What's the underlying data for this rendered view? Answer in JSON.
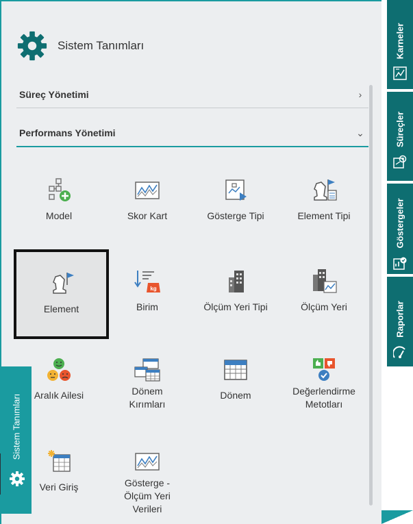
{
  "panel": {
    "title": "Sistem Tanımları",
    "sections": [
      {
        "label": "Süreç Yönetimi",
        "chevron": "›"
      },
      {
        "label": "Performans Yönetimi",
        "chevron": "⌄"
      }
    ],
    "tiles": [
      {
        "label": "Model",
        "icon": "model-icon"
      },
      {
        "label": "Skor Kart",
        "icon": "scorecard-icon"
      },
      {
        "label": "Gösterge Tipi",
        "icon": "indicator-type-icon"
      },
      {
        "label": "Element Tipi",
        "icon": "element-type-icon"
      },
      {
        "label": "Element",
        "icon": "element-icon"
      },
      {
        "label": "Birim",
        "icon": "unit-icon"
      },
      {
        "label": "Ölçüm Yeri Tipi",
        "icon": "measurement-place-type-icon"
      },
      {
        "label": "Ölçüm Yeri",
        "icon": "measurement-place-icon"
      },
      {
        "label": "Aralık Ailesi",
        "icon": "range-family-icon"
      },
      {
        "label": "Dönem\nKırımları",
        "icon": "period-breakdown-icon"
      },
      {
        "label": "Dönem",
        "icon": "period-icon"
      },
      {
        "label": "Değerlendirme\nMetotları",
        "icon": "evaluation-methods-icon"
      },
      {
        "label": "Veri Giriş",
        "icon": "data-entry-icon"
      },
      {
        "label": "Gösterge -\nÖlçüm Yeri\nVerileri",
        "icon": "indicator-measurement-data-icon"
      }
    ]
  },
  "sidebar": {
    "tabs": [
      {
        "label": "Karneler",
        "icon": "report-card-icon"
      },
      {
        "label": "Süreçler",
        "icon": "process-icon"
      },
      {
        "label": "Göstergeler",
        "icon": "indicators-icon"
      },
      {
        "label": "Raporlar",
        "icon": "reports-icon"
      }
    ],
    "active_tab": {
      "label": "Sistem Tanımları",
      "icon": "gear-icon"
    }
  },
  "colors": {
    "accent": "#1a9ba0",
    "sidebar_dark": "#0e6e71",
    "panel_bg": "#eceef0",
    "icon_blue": "#3d7fc1",
    "icon_green": "#4caf50",
    "icon_orange": "#e8552d"
  }
}
